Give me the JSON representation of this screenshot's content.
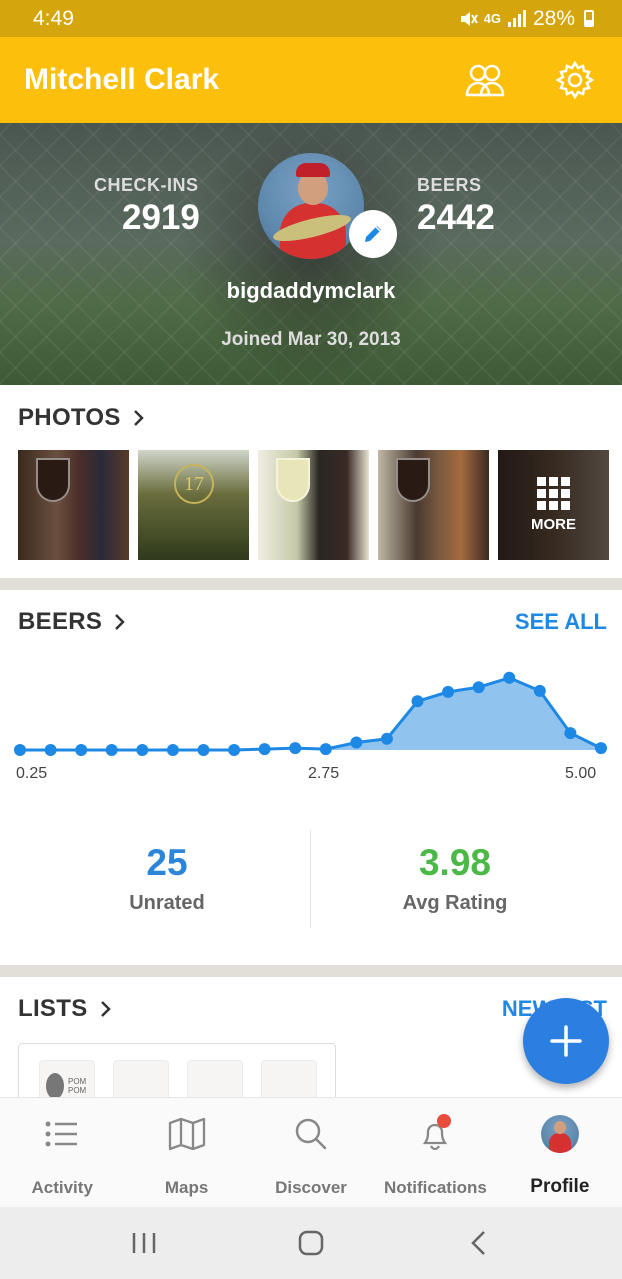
{
  "status_bar": {
    "time": "4:49",
    "network": "4G",
    "battery": "28%"
  },
  "app_bar": {
    "title": "Mitchell Clark"
  },
  "profile": {
    "checkins_label": "CHECK-INS",
    "checkins_value": "2919",
    "beers_label": "BEERS",
    "beers_value": "2442",
    "username": "bigdaddymclark",
    "joined": "Joined Mar 30, 2013"
  },
  "photos": {
    "title": "PHOTOS",
    "more_label": "MORE",
    "photo_2_label": "17"
  },
  "beers": {
    "title": "BEERS",
    "see_all": "SEE ALL",
    "unrated_value": "25",
    "unrated_label": "Unrated",
    "avg_rating_value": "3.98",
    "avg_rating_label": "Avg Rating",
    "unrated_color": "#2b85d8",
    "avg_color": "#4cb847"
  },
  "chart_data": {
    "type": "area",
    "x": [
      0.25,
      0.5,
      0.75,
      1.0,
      1.25,
      1.5,
      1.75,
      2.0,
      2.25,
      2.5,
      2.75,
      3.0,
      3.25,
      3.5,
      3.75,
      4.0,
      4.25,
      4.5,
      4.75,
      5.0
    ],
    "values": [
      0,
      0,
      0,
      0,
      0,
      0,
      0,
      0,
      1,
      2,
      1,
      8,
      12,
      52,
      62,
      67,
      77,
      63,
      18,
      2
    ],
    "tick_labels": [
      "0.25",
      "2.75",
      "5.00"
    ],
    "ylim": [
      0,
      80
    ],
    "grid": false,
    "color": "#1e88e5"
  },
  "lists": {
    "title": "LISTS",
    "new_list": "NEW LIST",
    "thumb_text": "POM POM"
  },
  "bottom_nav": {
    "items": [
      {
        "label": "Activity"
      },
      {
        "label": "Maps"
      },
      {
        "label": "Discover"
      },
      {
        "label": "Notifications"
      },
      {
        "label": "Profile"
      }
    ]
  },
  "colors": {
    "brand": "#fcc00c",
    "accent": "#1e88e5"
  }
}
